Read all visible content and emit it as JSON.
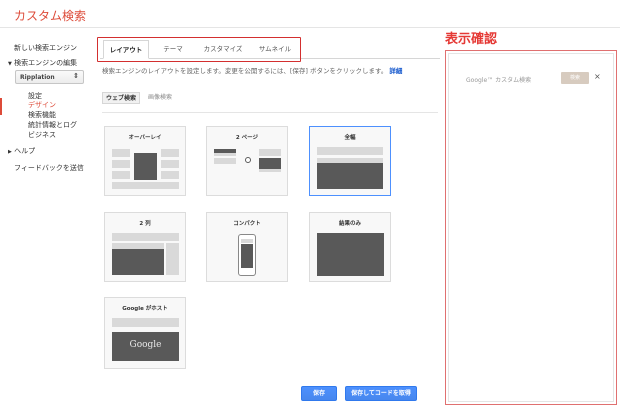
{
  "header": {
    "app_title": "カスタム検索"
  },
  "sidebar": {
    "new_engine": "新しい検索エンジン",
    "edit_engines": "検索エンジンの編集",
    "engine_select": "Ripplation",
    "items": [
      "設定",
      "デザイン",
      "検索機能",
      "統計情報とログ",
      "ビジネス"
    ],
    "help": "ヘルプ",
    "feedback": "フィードバックを送信"
  },
  "tabs": [
    "レイアウト",
    "テーマ",
    "カスタマイズ",
    "サムネイル"
  ],
  "description": {
    "text": "検索エンジンのレイアウトを設定します。変更を公開するには、[保存] ボタンをクリックします。",
    "link": "詳細"
  },
  "subtabs": [
    "ウェブ検索",
    "画像検索"
  ],
  "layouts": [
    "オーバーレイ",
    "2 ページ",
    "全幅",
    "2 列",
    "コンパクト",
    "結果のみ",
    "Google がホスト"
  ],
  "google_logo": "Google",
  "buttons": {
    "save": "保存",
    "save_get_code": "保存してコードを取得"
  },
  "preview": {
    "title": "表示確認",
    "search_label": "Google™ カスタム検索",
    "search_button": "検索",
    "clear": "×"
  },
  "colors": {
    "accent": "#dd4b39",
    "primary": "#4d90fe",
    "annotation": "#d32f2f"
  }
}
